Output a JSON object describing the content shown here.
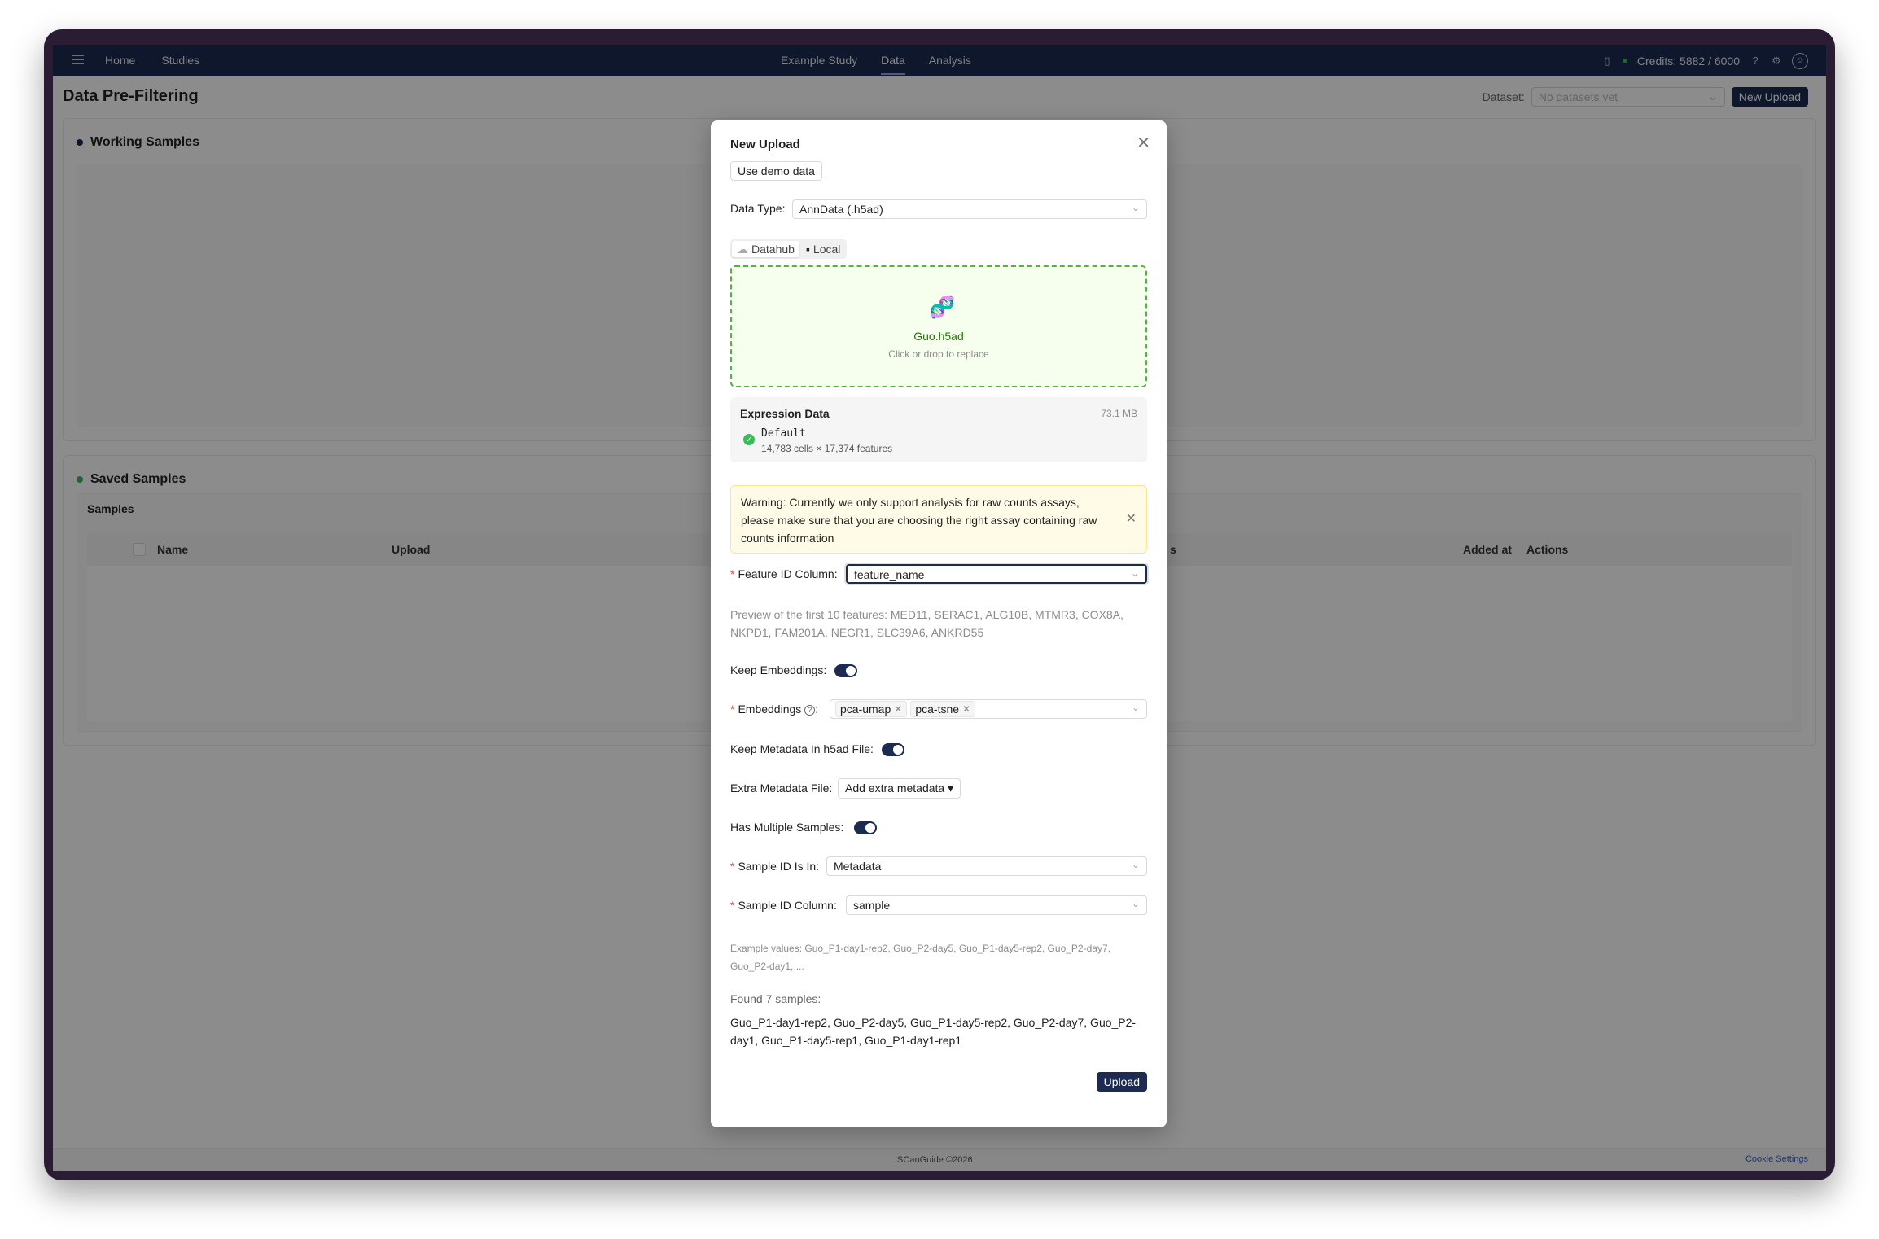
{
  "nav": {
    "home": "Home",
    "studies": "Studies",
    "study": "Example Study",
    "data": "Data",
    "analysis": "Analysis",
    "credits": "Credits: 5882 / 6000"
  },
  "page": {
    "title": "Data Pre-Filtering",
    "dataset_label": "Dataset:",
    "dataset_placeholder": "No datasets yet",
    "new_upload": "New Upload",
    "working_title": "Working Samples",
    "saved_title": "Saved Samples",
    "samples_label": "Samples",
    "columns": [
      "Name",
      "Upload",
      "s",
      "Added at",
      "Actions"
    ]
  },
  "footer": {
    "copyright": "ISCanGuide ©2026",
    "cookie": "Cookie Settings"
  },
  "modal": {
    "title": "New Upload",
    "demo_button": "Use demo data",
    "data_type_label": "Data Type",
    "data_type_value": "AnnData (.h5ad)",
    "tab_datahub": "Datahub",
    "tab_local": "Local",
    "file_name": "Guo.h5ad",
    "file_hint": "Click or drop to replace",
    "expr_title": "Expression Data",
    "expr_size": "73.1 MB",
    "expr_name": "Default",
    "expr_dims": "14,783 cells × 17,374 features",
    "warning": "Warning: Currently we only support analysis for raw counts assays, please make sure that you are choosing the right assay containing raw counts information",
    "feature_id_label": "Feature ID Column",
    "feature_id_value": "feature_name",
    "preview": "Preview of the first 10 features: MED11, SERAC1, ALG10B, MTMR3, COX8A, NKPD1, FAM201A, NEGR1, SLC39A6, ANKRD55",
    "keep_embeddings_label": "Keep Embeddings",
    "embeddings_label": "Embeddings",
    "embedding_tags": [
      "pca-umap",
      "pca-tsne"
    ],
    "keep_metadata_label": "Keep Metadata In h5ad File",
    "extra_metadata_label": "Extra Metadata File",
    "extra_metadata_button": "Add extra metadata",
    "multiple_samples_label": "Has Multiple Samples",
    "sample_id_in_label": "Sample ID Is In",
    "sample_id_in_value": "Metadata",
    "sample_id_col_label": "Sample ID Column",
    "sample_id_col_value": "sample",
    "examples": "Example values: Guo_P1-day1-rep2, Guo_P2-day5, Guo_P1-day5-rep2, Guo_P2-day7, Guo_P2-day1, ...",
    "found": "Found 7 samples",
    "found_list": "Guo_P1-day1-rep2, Guo_P2-day5, Guo_P1-day5-rep2, Guo_P2-day7, Guo_P2-day1, Guo_P1-day5-rep1, Guo_P1-day1-rep1",
    "upload_button": "Upload"
  },
  "colors": {
    "navy": "#1d2b52",
    "success_green": "#3dbb5b",
    "working_dot": "#1d2b52",
    "saved_dot": "#3dbb5b"
  }
}
